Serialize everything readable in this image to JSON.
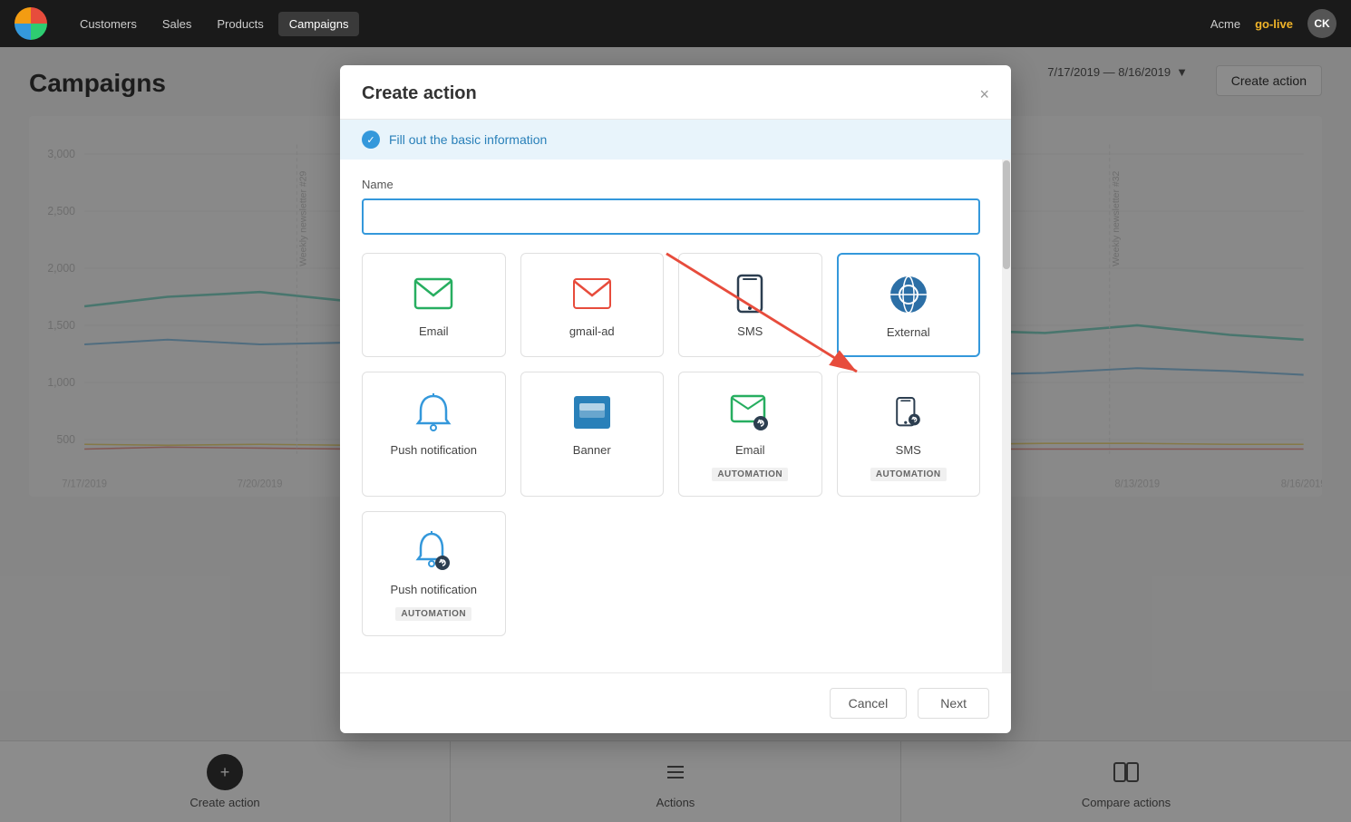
{
  "app": {
    "logo_alt": "App logo"
  },
  "topnav": {
    "items": [
      {
        "label": "Customers",
        "has_dropdown": true,
        "active": false
      },
      {
        "label": "Sales",
        "has_dropdown": false,
        "active": false
      },
      {
        "label": "Products",
        "has_dropdown": false,
        "active": false
      },
      {
        "label": "Campaigns",
        "has_dropdown": true,
        "active": true
      }
    ],
    "workspace": "Acme",
    "golive": "go-live",
    "avatar": "CK"
  },
  "campaigns": {
    "title": "Campaigns",
    "date_range": "7/17/2019 — 8/16/2019",
    "create_action_btn": "Create action",
    "y_labels": [
      "3,000",
      "2,500",
      "2,000",
      "1,500",
      "1,000",
      "500",
      ""
    ]
  },
  "bottom_bar": {
    "items": [
      {
        "label": "Create action",
        "icon": "plus"
      },
      {
        "label": "Actions",
        "icon": "list"
      },
      {
        "label": "Compare actions",
        "icon": "compare"
      }
    ]
  },
  "modal": {
    "title": "Create action",
    "close_label": "×",
    "info_banner": "Fill out the basic information",
    "field_label": "Name",
    "name_placeholder": "",
    "action_types": [
      {
        "id": "email",
        "label": "Email",
        "automation": false,
        "icon": "email"
      },
      {
        "id": "gmail-ad",
        "label": "gmail-ad",
        "automation": false,
        "icon": "gmail"
      },
      {
        "id": "sms",
        "label": "SMS",
        "automation": false,
        "icon": "sms"
      },
      {
        "id": "external",
        "label": "External",
        "automation": false,
        "icon": "external"
      },
      {
        "id": "push-notification",
        "label": "Push notification",
        "automation": false,
        "icon": "push"
      },
      {
        "id": "banner",
        "label": "Banner",
        "automation": false,
        "icon": "banner"
      },
      {
        "id": "email-automation",
        "label": "Email",
        "automation": true,
        "automation_label": "AUTOMATION",
        "icon": "email-automation"
      },
      {
        "id": "sms-automation",
        "label": "SMS",
        "automation": true,
        "automation_label": "AUTOMATION",
        "icon": "sms-automation"
      },
      {
        "id": "push-automation",
        "label": "Push notification",
        "automation": true,
        "automation_label": "AUTOMATION",
        "icon": "push-automation"
      }
    ],
    "cancel_label": "Cancel",
    "next_label": "Next"
  }
}
